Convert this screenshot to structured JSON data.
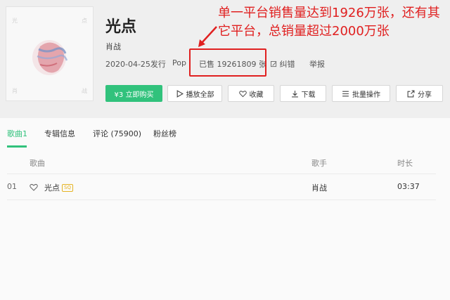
{
  "album": {
    "cover_corner_tl": "光",
    "cover_corner_tr": "点",
    "cover_corner_bl": "肖",
    "cover_corner_br": "战",
    "title": "光点",
    "artist": "肖战",
    "release": "2020-04-25发行",
    "genre": "Pop",
    "sales": "已售 19261809 张",
    "report_error": "纠错",
    "report": "举报"
  },
  "annotation": {
    "text": "单一平台销售量达到1926万张，还有其它平台，总销量超过2000万张",
    "color": "#e02020"
  },
  "actions": {
    "buy": "¥3 立即购买",
    "play_all": "播放全部",
    "collect": "收藏",
    "download": "下载",
    "batch": "批量操作",
    "share": "分享"
  },
  "tabs": [
    "歌曲1",
    "专辑信息",
    "评论 (75900)",
    "粉丝榜"
  ],
  "table": {
    "headers": {
      "song": "歌曲",
      "singer": "歌手",
      "duration": "时长"
    },
    "rows": [
      {
        "index": "01",
        "name": "光点",
        "badge": "SQ",
        "singer": "肖战",
        "duration": "03:37"
      }
    ]
  },
  "colors": {
    "accent": "#31c27c",
    "annotation": "#e02020",
    "badge": "#e6b322"
  }
}
